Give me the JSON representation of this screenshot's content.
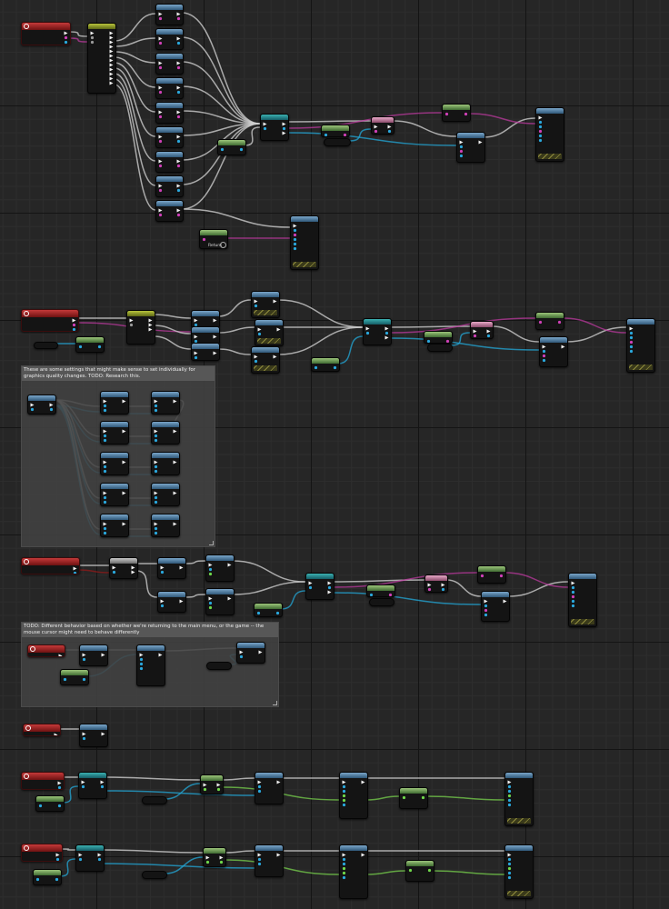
{
  "app": {
    "view": "blueprint-event-graph",
    "colors": {
      "background": "#262626",
      "grid_major": "#141414",
      "grid_minor": "#2d2d2d",
      "node_body": "#141414",
      "event_header": "#9a2020",
      "function_header": "#5a86aa",
      "pure_header": "#6e9c55",
      "macro_header": "#9aa628",
      "cast_header": "#2a8e94",
      "exec_wire": "#cfcfcf",
      "object_wire": "#23a8d8",
      "string_wire": "#c43aa5",
      "float_wire": "#7cdc4e",
      "bool_wire": "#8a1a1a"
    }
  },
  "comments": [
    {
      "id": "graphics",
      "text": "These are some settings that might make sense to set individually for graphics quality changes. TODO: Research this."
    },
    {
      "id": "cursor",
      "text": "TODO: Different behavior based on whether we're returning to the main menu, or the game -- the mouse cursor might need to behave differently"
    }
  ],
  "node_text": {
    "var_get": "Return"
  },
  "icons": {
    "event": "event-icon",
    "exec_pin": "exec-pin-icon",
    "data_pin": "data-pin-icon",
    "watch": "eye-icon",
    "resize": "resize-grip-icon"
  }
}
